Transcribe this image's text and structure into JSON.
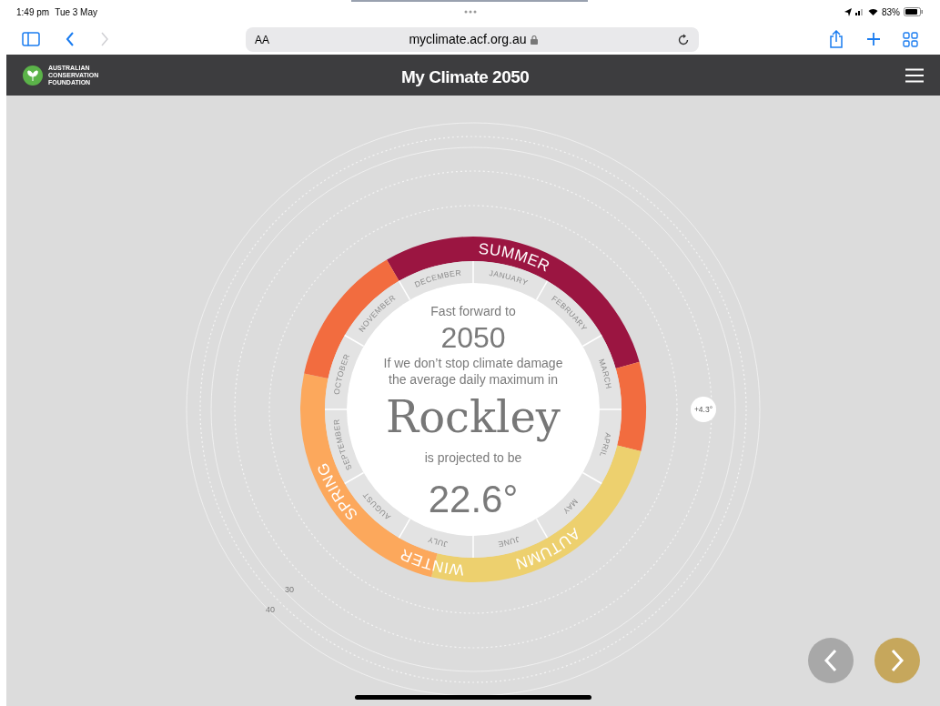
{
  "status_bar": {
    "time": "1:49 pm",
    "date": "Tue 3 May",
    "battery": "83%"
  },
  "browser": {
    "text_size_button": "AA",
    "url": "myclimate.acf.org.au"
  },
  "header": {
    "logo_lines": [
      "AUSTRALIAN",
      "CONSERVATION",
      "FOUNDATION"
    ],
    "title": "My Climate 2050"
  },
  "dial": {
    "season_bands": [
      {
        "color": "#9b1541"
      },
      {
        "color": "#f26c3f"
      },
      {
        "color": "#edd06e"
      },
      {
        "color": "#fca85c"
      },
      {
        "color": "#f26c3f"
      }
    ],
    "season_labels": [
      "SUMMER",
      "SPRING",
      "WINTER",
      "AUTUMN"
    ],
    "months": [
      "DECEMBER",
      "JANUARY",
      "NOVEMBER",
      "FEBRUARY",
      "OCTOBER",
      "MARCH",
      "SEPTEMBER",
      "APRIL",
      "AUGUST",
      "MAY",
      "JULY",
      "JUNE"
    ],
    "intro": "Fast forward to",
    "year": "2050",
    "sentence": "If we don’t stop climate damage the average daily maximum in",
    "location": "Rockley",
    "subtitle": "is projected to be",
    "temperature": "22.6°",
    "marker": "+4.3°",
    "scale_labels": [
      "30",
      "40"
    ]
  },
  "nav": [
    {
      "kind": "previous",
      "enabled": false
    },
    {
      "kind": "next",
      "enabled": true
    }
  ]
}
